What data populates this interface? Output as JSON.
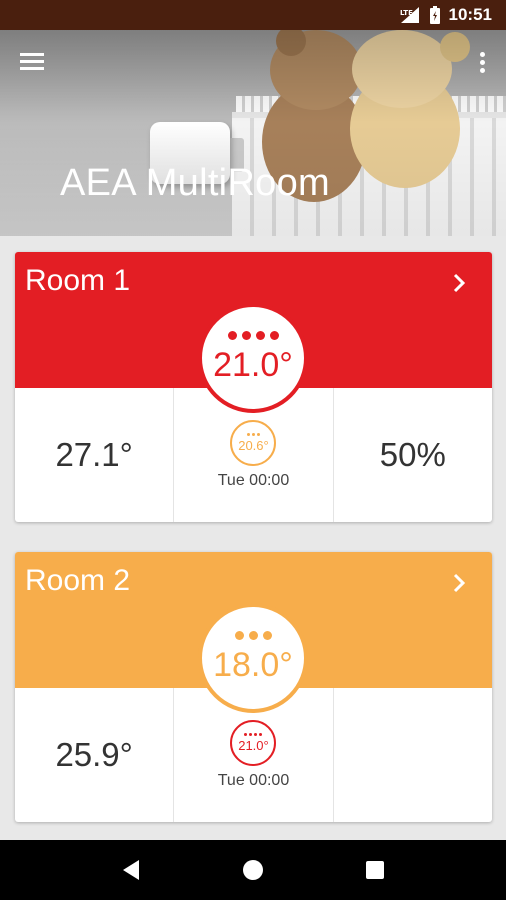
{
  "status_bar": {
    "time": "10:51",
    "network": "LTE"
  },
  "app": {
    "title": "AEA MultiRoom"
  },
  "colors": {
    "heat": "#e31e24",
    "warm": "#f7ad4b",
    "dark_text": "#333333"
  },
  "rooms": [
    {
      "name": "Room 1",
      "setpoint": "21.0°",
      "setpoint_dots": 4,
      "current_temp": "27.1°",
      "next_setpoint": "20.6°",
      "next_time": "Tue 00:00",
      "humidity": "50%"
    },
    {
      "name": "Room 2",
      "setpoint": "18.0°",
      "setpoint_dots": 3,
      "current_temp": "25.9°",
      "next_setpoint": "21.0°",
      "next_time": "Tue 00:00",
      "humidity": ""
    }
  ],
  "icons": {
    "menu": "menu-icon",
    "overflow": "more-vert-icon",
    "chevron": "chevron-right-icon",
    "back": "back-icon",
    "home": "home-icon",
    "recents": "recents-icon"
  }
}
